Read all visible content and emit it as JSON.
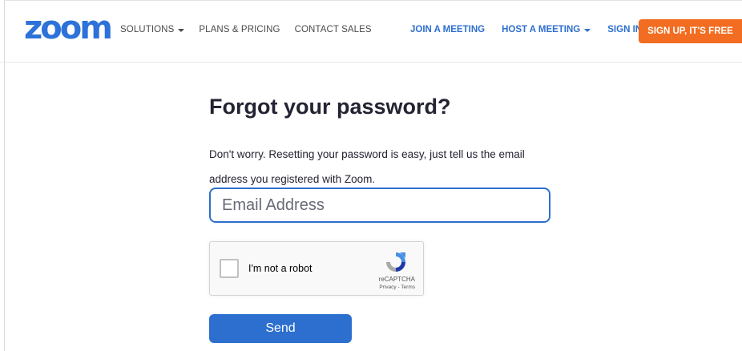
{
  "header": {
    "logo": "zoom",
    "nav_left": [
      {
        "label": "SOLUTIONS",
        "dropdown": true
      },
      {
        "label": "PLANS & PRICING",
        "dropdown": false
      },
      {
        "label": "CONTACT SALES",
        "dropdown": false
      }
    ],
    "nav_right": [
      {
        "label": "JOIN A MEETING",
        "dropdown": false
      },
      {
        "label": "HOST A MEETING",
        "dropdown": true
      },
      {
        "label": "SIGN IN",
        "dropdown": false
      }
    ],
    "signup_label": "SIGN UP, IT'S FREE"
  },
  "form": {
    "title": "Forgot your password?",
    "description": "Don't worry. Resetting your password is easy, just tell us the email address you registered with Zoom.",
    "email_placeholder": "Email Address",
    "email_value": "",
    "captcha": {
      "label": "I'm not a robot",
      "brand": "reCAPTCHA",
      "links": "Privacy - Terms",
      "checked": false
    },
    "send_label": "Send"
  },
  "colors": {
    "brand_blue": "#2d72d9",
    "link_blue": "#2d6fcf",
    "signup_orange": "#f26d21"
  }
}
